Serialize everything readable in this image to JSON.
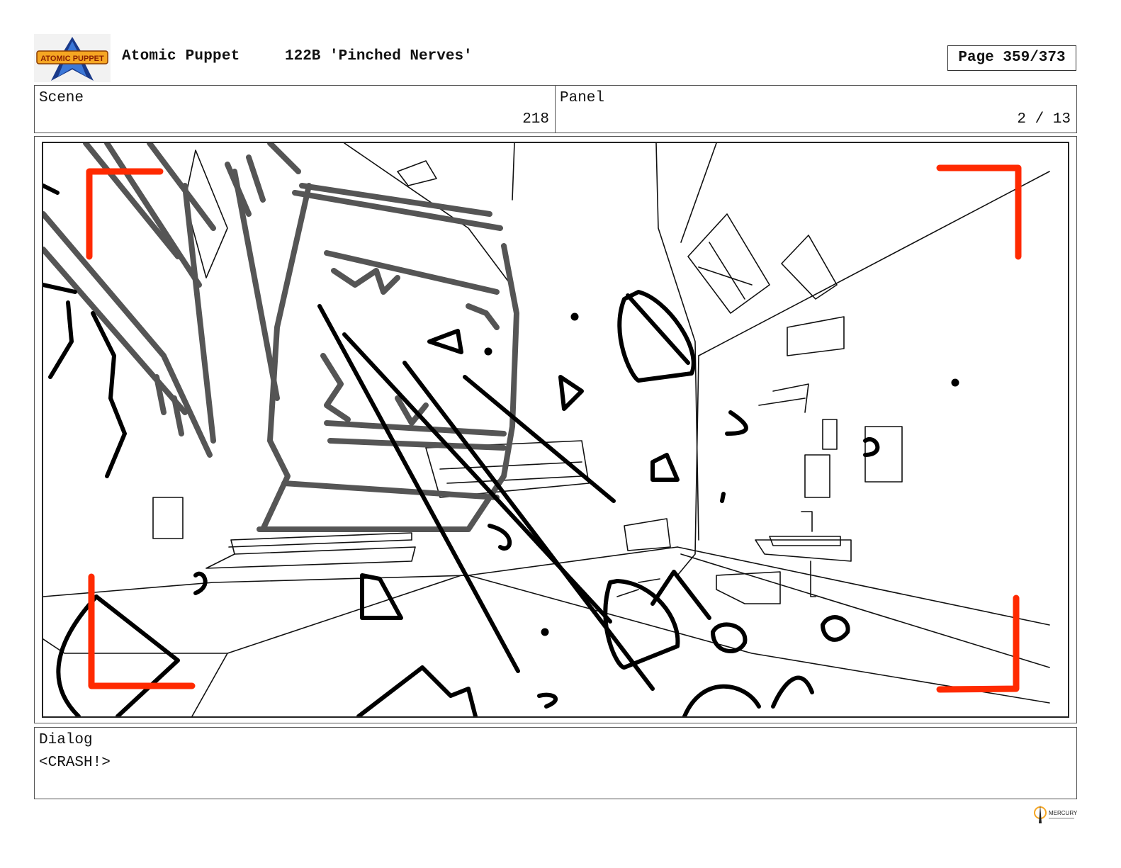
{
  "header": {
    "logo_text": "ATOMIC PUPPET",
    "show_title": "Atomic Puppet",
    "episode_title": "122B 'Pinched Nerves'",
    "page_label": "Page 359/373"
  },
  "scene": {
    "label": "Scene",
    "value": "218"
  },
  "panel": {
    "label": "Panel",
    "value": "2 / 13"
  },
  "dialog": {
    "label": "Dialog",
    "text": "<CRASH!>"
  },
  "footer": {
    "studio_logo_text": "MERCURY"
  },
  "colors": {
    "frame_marker": "#ff2a00",
    "sketch_black": "#000000",
    "sketch_grey": "#555555",
    "logo_blue": "#1a3a8a",
    "logo_orange": "#f5a623"
  }
}
